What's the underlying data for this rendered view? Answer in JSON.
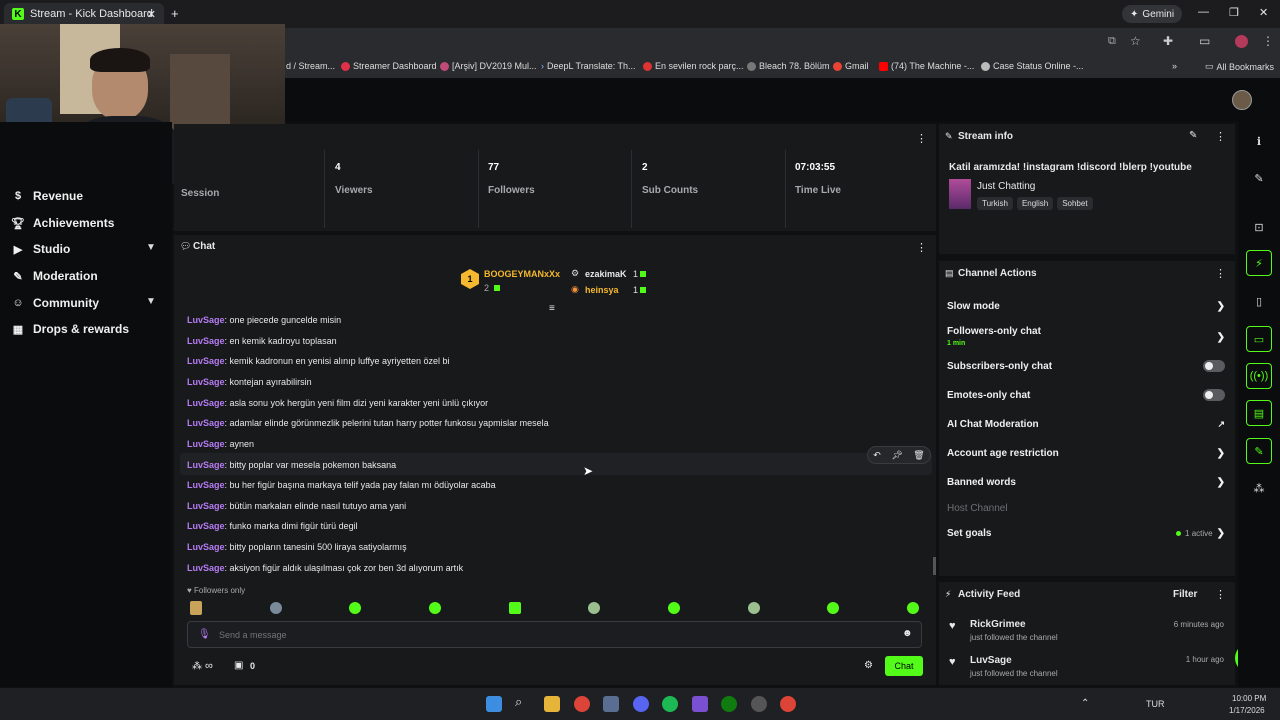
{
  "browser": {
    "tab_title": "Stream - Kick Dashboard",
    "gemini": "Gemini",
    "all_bookmarks": "All Bookmarks",
    "bookmarks": [
      "d / Stream...",
      "Streamer Dashboard",
      "[Arşiv] DV2019 Mul...",
      "DeepL Translate: Th...",
      "En sevilen rock parç...",
      "Bleach 78. Bölüm",
      "Gmail",
      "(74) The Machine -...",
      "Case Status Online -..."
    ]
  },
  "sidebar": {
    "items": [
      {
        "label": "Revenue",
        "icon": "dollar-icon"
      },
      {
        "label": "Achievements",
        "icon": "trophy-icon"
      },
      {
        "label": "Studio",
        "icon": "video-icon",
        "chevron": true
      },
      {
        "label": "Moderation",
        "icon": "wrench-icon"
      },
      {
        "label": "Community",
        "icon": "users-icon",
        "chevron": true
      },
      {
        "label": "Drops & rewards",
        "icon": "gift-icon"
      }
    ]
  },
  "stats": {
    "session_label": "Session",
    "items": [
      {
        "value": "4",
        "label": "Viewers"
      },
      {
        "value": "77",
        "label": "Followers"
      },
      {
        "value": "2",
        "label": "Sub Counts"
      },
      {
        "value": "07:03:55",
        "label": "Time Live"
      }
    ]
  },
  "chat": {
    "title": "Chat",
    "leaders": [
      {
        "name": "BOOGEYMANxXx",
        "rank": "1",
        "count": "2"
      },
      {
        "name": "ezakimaK",
        "count": "1"
      },
      {
        "name": "heinsya",
        "count": "1"
      }
    ],
    "messages": [
      {
        "user": "LuvSage",
        "text": "one piecede guncelde misin"
      },
      {
        "user": "LuvSage",
        "text": "en kemik kadroyu toplasan"
      },
      {
        "user": "LuvSage",
        "text": "kemik kadronun en yenisi alınıp luffye ayriyetten özel bi"
      },
      {
        "user": "LuvSage",
        "text": "kontejan ayırabilirsin"
      },
      {
        "user": "LuvSage",
        "text": "asla sonu yok hergün yeni film dizi yeni karakter yeni ünlü çıkıyor"
      },
      {
        "user": "LuvSage",
        "text": "adamlar elinde görünmezlik pelerini tutan harry potter funkosu yapmislar mesela"
      },
      {
        "user": "LuvSage",
        "text": "aynen"
      },
      {
        "user": "LuvSage",
        "text": "bitty poplar var mesela pokemon baksana"
      },
      {
        "user": "LuvSage",
        "text": "bu her figür başına markaya telif yada pay falan mı ödüyolar acaba"
      },
      {
        "user": "LuvSage",
        "text": "bütün markaları elinde nasıl tutuyo ama yani"
      },
      {
        "user": "LuvSage",
        "text": "funko marka dimi figür türü degil"
      },
      {
        "user": "LuvSage",
        "text": "bitty popların tanesini 500 liraya satiyolarmış"
      },
      {
        "user": "LuvSage",
        "text": "aksiyon figür aldık ulaşılması çok zor ben 3d alıyorum artık"
      }
    ],
    "followers_only": "Followers only",
    "input_placeholder": "Send a message",
    "points": "∞",
    "gifts": "0",
    "send_label": "Chat"
  },
  "stream_info": {
    "title": "Stream info",
    "stream_title": "Katil aramızda! !instagram !discord !blerp !youtube",
    "category": "Just Chatting",
    "tags": [
      "Turkish",
      "English",
      "Sohbet"
    ]
  },
  "channel_actions": {
    "title": "Channel Actions",
    "slow_mode": "Slow mode",
    "followers_only": "Followers-only chat",
    "followers_only_value": "1 min",
    "subscribers_only": "Subscribers-only chat",
    "emotes_only": "Emotes-only chat",
    "ai_moderation": "AI Chat Moderation",
    "account_age": "Account age restriction",
    "banned_words": "Banned words",
    "host_channel": "Host Channel",
    "set_goals": "Set goals",
    "goals_status": "1 active"
  },
  "activity": {
    "title": "Activity Feed",
    "filter": "Filter",
    "items": [
      {
        "name": "RickGrimee",
        "desc": "just followed the channel",
        "time": "6 minutes ago"
      },
      {
        "name": "LuvSage",
        "desc": "just followed the channel",
        "time": "1 hour ago"
      }
    ]
  },
  "taskbar": {
    "lang": "TUR",
    "time": "10:00 PM",
    "date": "1/17/2026"
  },
  "colors": {
    "accent": "#53fc18",
    "username": "#b57cf4",
    "gold": "#f5b82e"
  }
}
